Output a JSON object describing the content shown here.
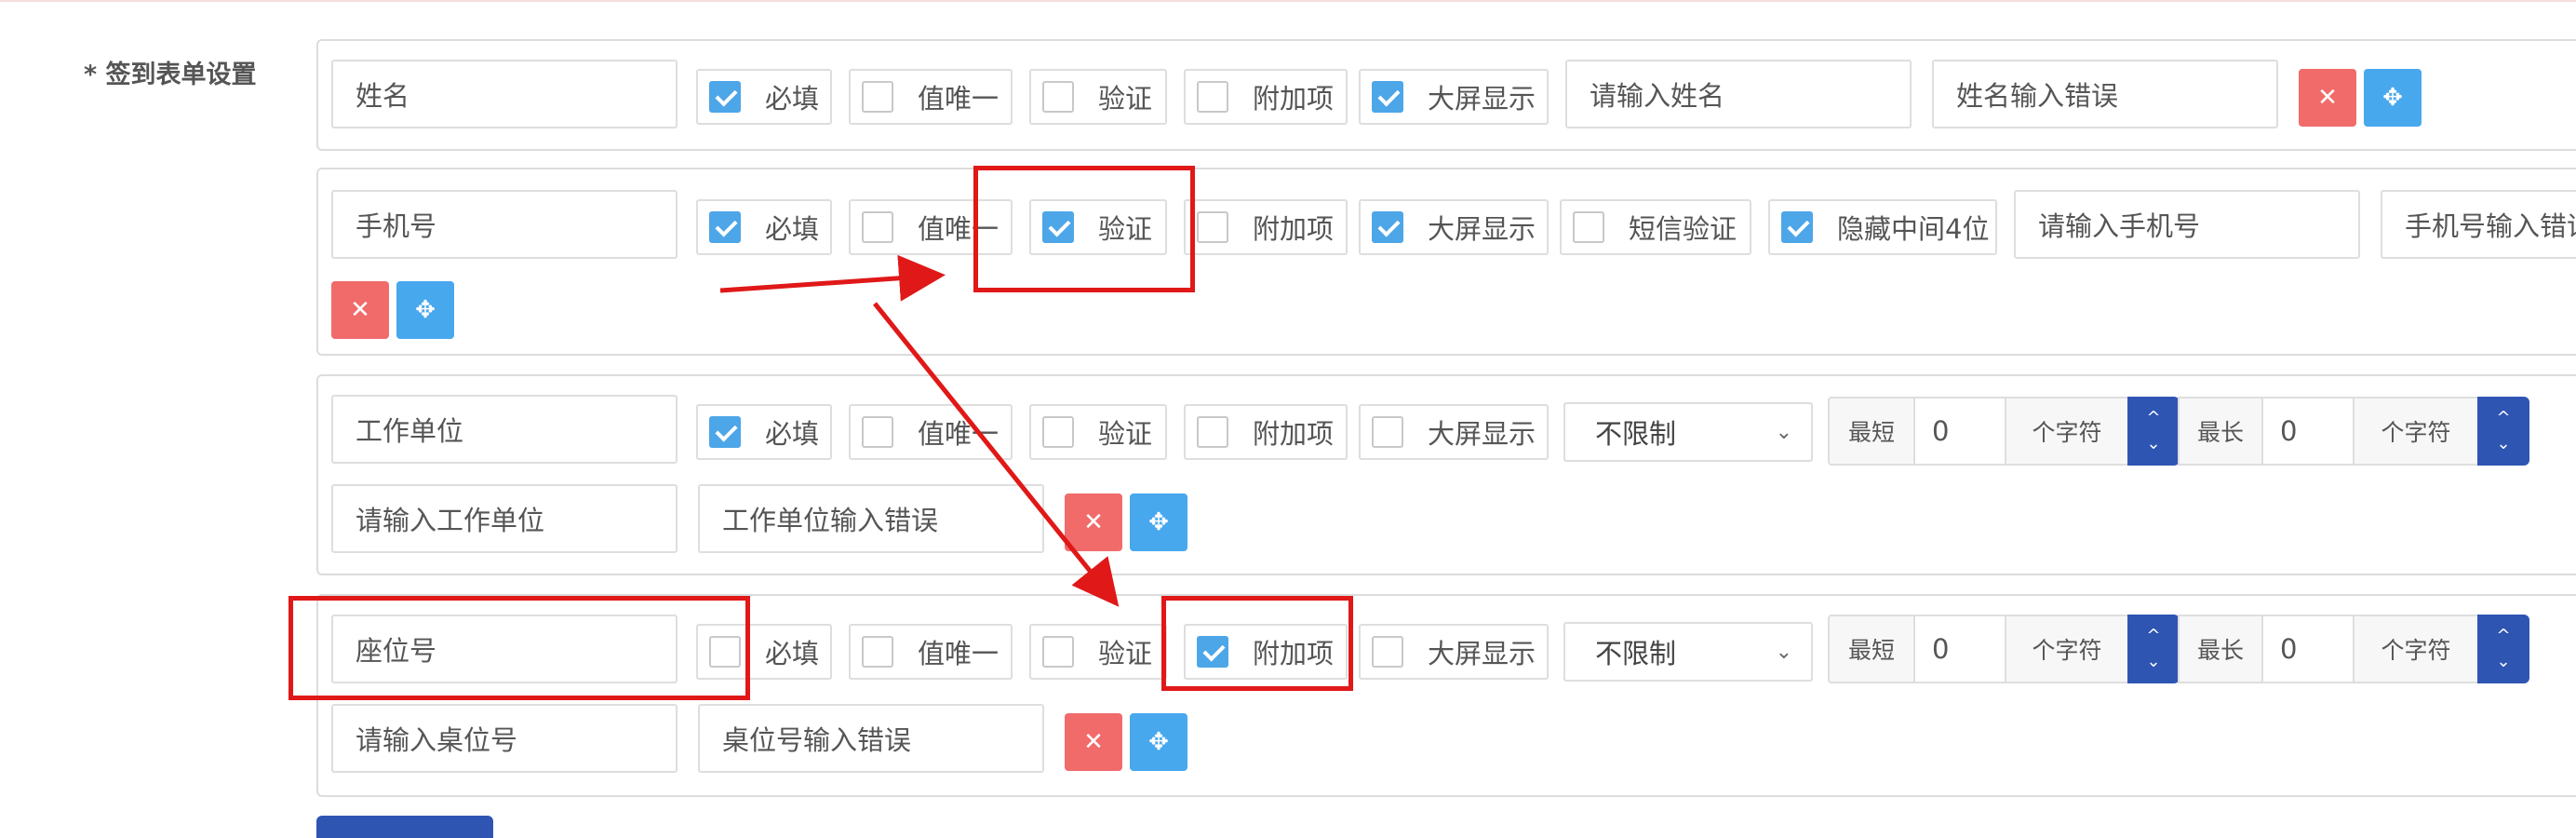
{
  "section_label": "* 签到表单设置",
  "rows": [
    {
      "name": "姓名",
      "checks": [
        {
          "label": "必填",
          "checked": true
        },
        {
          "label": "值唯一",
          "checked": false
        },
        {
          "label": "验证",
          "checked": false
        },
        {
          "label": "附加项",
          "checked": false
        },
        {
          "label": "大屏显示",
          "checked": true
        }
      ],
      "placeholder": "请输入姓名",
      "error": "姓名输入错误"
    },
    {
      "name": "手机号",
      "checks": [
        {
          "label": "必填",
          "checked": true
        },
        {
          "label": "值唯一",
          "checked": false
        },
        {
          "label": "验证",
          "checked": true
        },
        {
          "label": "附加项",
          "checked": false
        },
        {
          "label": "大屏显示",
          "checked": true
        },
        {
          "label": "短信验证",
          "checked": false
        },
        {
          "label": "隐藏中间4位",
          "checked": true
        }
      ],
      "placeholder": "请输入手机号",
      "error": "手机号输入错误"
    },
    {
      "name": "工作单位",
      "checks": [
        {
          "label": "必填",
          "checked": true
        },
        {
          "label": "值唯一",
          "checked": false
        },
        {
          "label": "验证",
          "checked": false
        },
        {
          "label": "附加项",
          "checked": false
        },
        {
          "label": "大屏显示",
          "checked": false
        }
      ],
      "select": "不限制",
      "min_label": "最短",
      "min_value": "0",
      "max_label": "最长",
      "max_value": "0",
      "unit": "个字符",
      "placeholder": "请输入工作单位",
      "error": "工作单位输入错误"
    },
    {
      "name": "座位号",
      "checks": [
        {
          "label": "必填",
          "checked": false
        },
        {
          "label": "值唯一",
          "checked": false
        },
        {
          "label": "验证",
          "checked": false
        },
        {
          "label": "附加项",
          "checked": true
        },
        {
          "label": "大屏显示",
          "checked": false
        }
      ],
      "select": "不限制",
      "min_label": "最短",
      "min_value": "0",
      "max_label": "最长",
      "max_value": "0",
      "unit": "个字符",
      "placeholder": "请输入桌位号",
      "error": "桌位号输入错误"
    }
  ],
  "icons": {
    "delete": "close-icon",
    "move": "move-icon"
  },
  "colors": {
    "checked": "#4da6e8",
    "delete": "#f16b6b",
    "move": "#48a8ee",
    "spinner": "#2f55b3",
    "annotation": "#e01818"
  }
}
